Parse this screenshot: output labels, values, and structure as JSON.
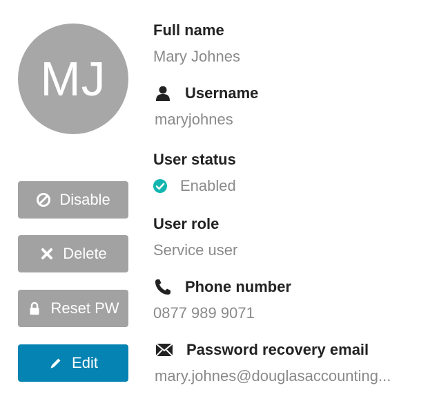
{
  "avatar": {
    "initials": "MJ"
  },
  "actions": {
    "disable": "Disable",
    "delete": "Delete",
    "reset_pw": "Reset PW",
    "edit": "Edit"
  },
  "fields": {
    "full_name": {
      "label": "Full name",
      "value": "Mary Johnes"
    },
    "username": {
      "label": "Username",
      "value": "maryjohnes",
      "icon": "user-icon"
    },
    "user_status": {
      "label": "User status",
      "value": "Enabled",
      "icon": "check-circle-icon"
    },
    "user_role": {
      "label": "User role",
      "value": "Service user"
    },
    "phone": {
      "label": "Phone number",
      "value": "0877 989 9071",
      "icon": "phone-icon"
    },
    "recovery_email": {
      "label": "Password recovery email",
      "value": "mary.johnes@douglasaccounting...",
      "icon": "envelope-icon"
    }
  },
  "colors": {
    "avatar_bg": "#a7a7a7",
    "button_gray": "#a2a2a2",
    "button_primary": "#0583b2",
    "status_ok": "#12b5b0",
    "value_text": "#8a8a8a"
  }
}
